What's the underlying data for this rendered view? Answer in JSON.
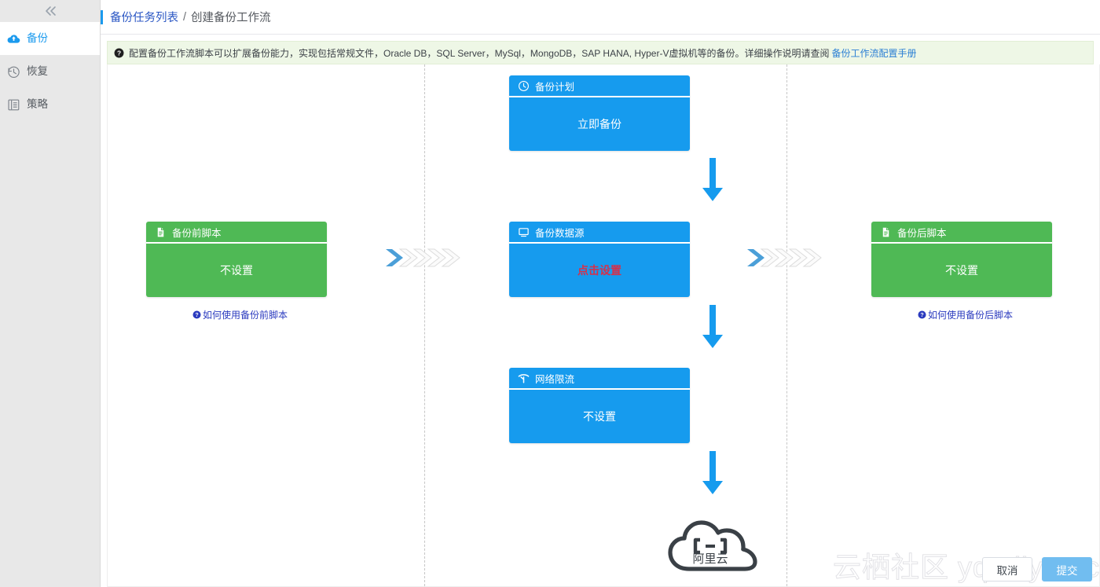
{
  "sidebar": {
    "collapse_icon": "double-chevron-left-icon",
    "items": [
      {
        "label": "备份",
        "icon": "cloud-upload-icon",
        "active": true
      },
      {
        "label": "恢复",
        "icon": "clock-restore-icon",
        "active": false
      },
      {
        "label": "策略",
        "icon": "policy-list-icon",
        "active": false
      }
    ]
  },
  "breadcrumb": {
    "link": "备份任务列表",
    "separator": "/",
    "current": "创建备份工作流"
  },
  "notice": {
    "icon": "question-mark-icon",
    "text": "配置备份工作流脚本可以扩展备份能力，实现包括常规文件，Oracle DB，SQL Server，MySql，MongoDB，SAP HANA, Hyper-V虚拟机等的备份。详细操作说明请查阅",
    "link": "备份工作流配置手册"
  },
  "workflow": {
    "cards": {
      "schedule": {
        "title": "备份计划",
        "icon": "clock-icon",
        "value": "立即备份",
        "color": "#169bee"
      },
      "pre_script": {
        "title": "备份前脚本",
        "icon": "file-icon",
        "value": "不设置",
        "color": "#4fb955"
      },
      "datasource": {
        "title": "备份数据源",
        "icon": "monitor-icon",
        "value": "点击设置",
        "color": "#169bee",
        "value_color": "#d6304a"
      },
      "post_script": {
        "title": "备份后脚本",
        "icon": "file-icon",
        "value": "不设置",
        "color": "#4fb955"
      },
      "throttle": {
        "title": "网络限流",
        "icon": "wifi-icon",
        "value": "不设置",
        "color": "#169bee"
      }
    },
    "help_links": {
      "pre": "如何使用备份前脚本",
      "post": "如何使用备份后脚本"
    },
    "cloud_logo": {
      "name": "alibaba-cloud-logo",
      "text": "阿里云"
    }
  },
  "watermark": "云栖社区 yq.aliyun.com",
  "footer": {
    "cancel": "取消",
    "submit": "提交"
  }
}
